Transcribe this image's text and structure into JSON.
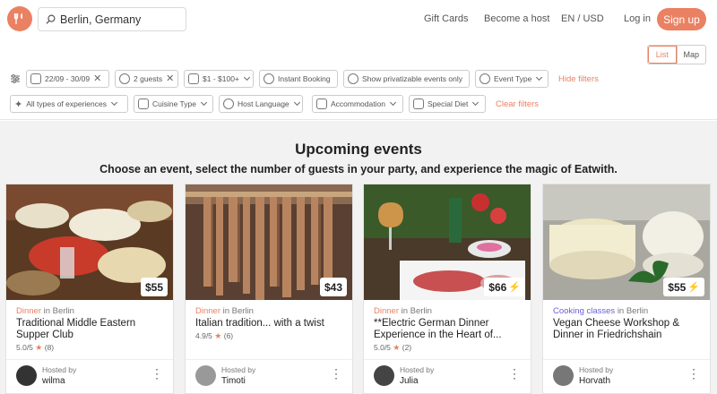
{
  "header": {
    "search_value": "Berlin, Germany",
    "nav": {
      "gift_cards": "Gift Cards",
      "become_host": "Become a host",
      "locale": "EN / USD",
      "login": "Log in",
      "signup": "Sign up"
    },
    "accent_color": "#ea8163"
  },
  "view_toggle": {
    "list": "List",
    "map": "Map",
    "active": "List"
  },
  "filters": {
    "dates": "22/09 - 30/09",
    "guests": "2 guests",
    "price": "$1 - $100+",
    "instant_booking": "Instant Booking",
    "privatizable": "Show privatizable events only",
    "event_type": "Event Type",
    "hide_filters": "Hide filters",
    "experiences": "All types of experiences",
    "cuisine": "Cuisine Type",
    "host_language": "Host Language",
    "accommodation": "Accommodation",
    "special_diet": "Special Diet",
    "clear_filters": "Clear filters"
  },
  "main": {
    "heading": "Upcoming events",
    "subheading": "Choose an event, select the number of guests in your party, and experience the magic of Eatwith."
  },
  "events": [
    {
      "price": "$55",
      "instant": false,
      "category": "Dinner",
      "location": "in Berlin",
      "title": "Traditional Middle Eastern Supper Club",
      "rating": "5.0/5",
      "reviews": "(8)",
      "hosted_by": "Hosted by",
      "host": "wilma"
    },
    {
      "price": "$43",
      "instant": false,
      "category": "Dinner",
      "location": "in Berlin",
      "title": "Italian tradition... with a twist",
      "rating": "4.9/5",
      "reviews": "(6)",
      "hosted_by": "Hosted by",
      "host": "Timoti"
    },
    {
      "price": "$66",
      "instant": true,
      "category": "Dinner",
      "location": "in Berlin",
      "title": "**Electric German Dinner Experience in the Heart of...",
      "rating": "5.0/5",
      "reviews": "(2)",
      "hosted_by": "Hosted by",
      "host": "Julia"
    },
    {
      "price": "$55",
      "instant": true,
      "category": "Cooking classes",
      "location": "in Berlin",
      "title": "Vegan Cheese Workshop & Dinner in Friedrichshain",
      "rating": "",
      "reviews": "",
      "hosted_by": "Hosted by",
      "host": "Horvath"
    }
  ]
}
